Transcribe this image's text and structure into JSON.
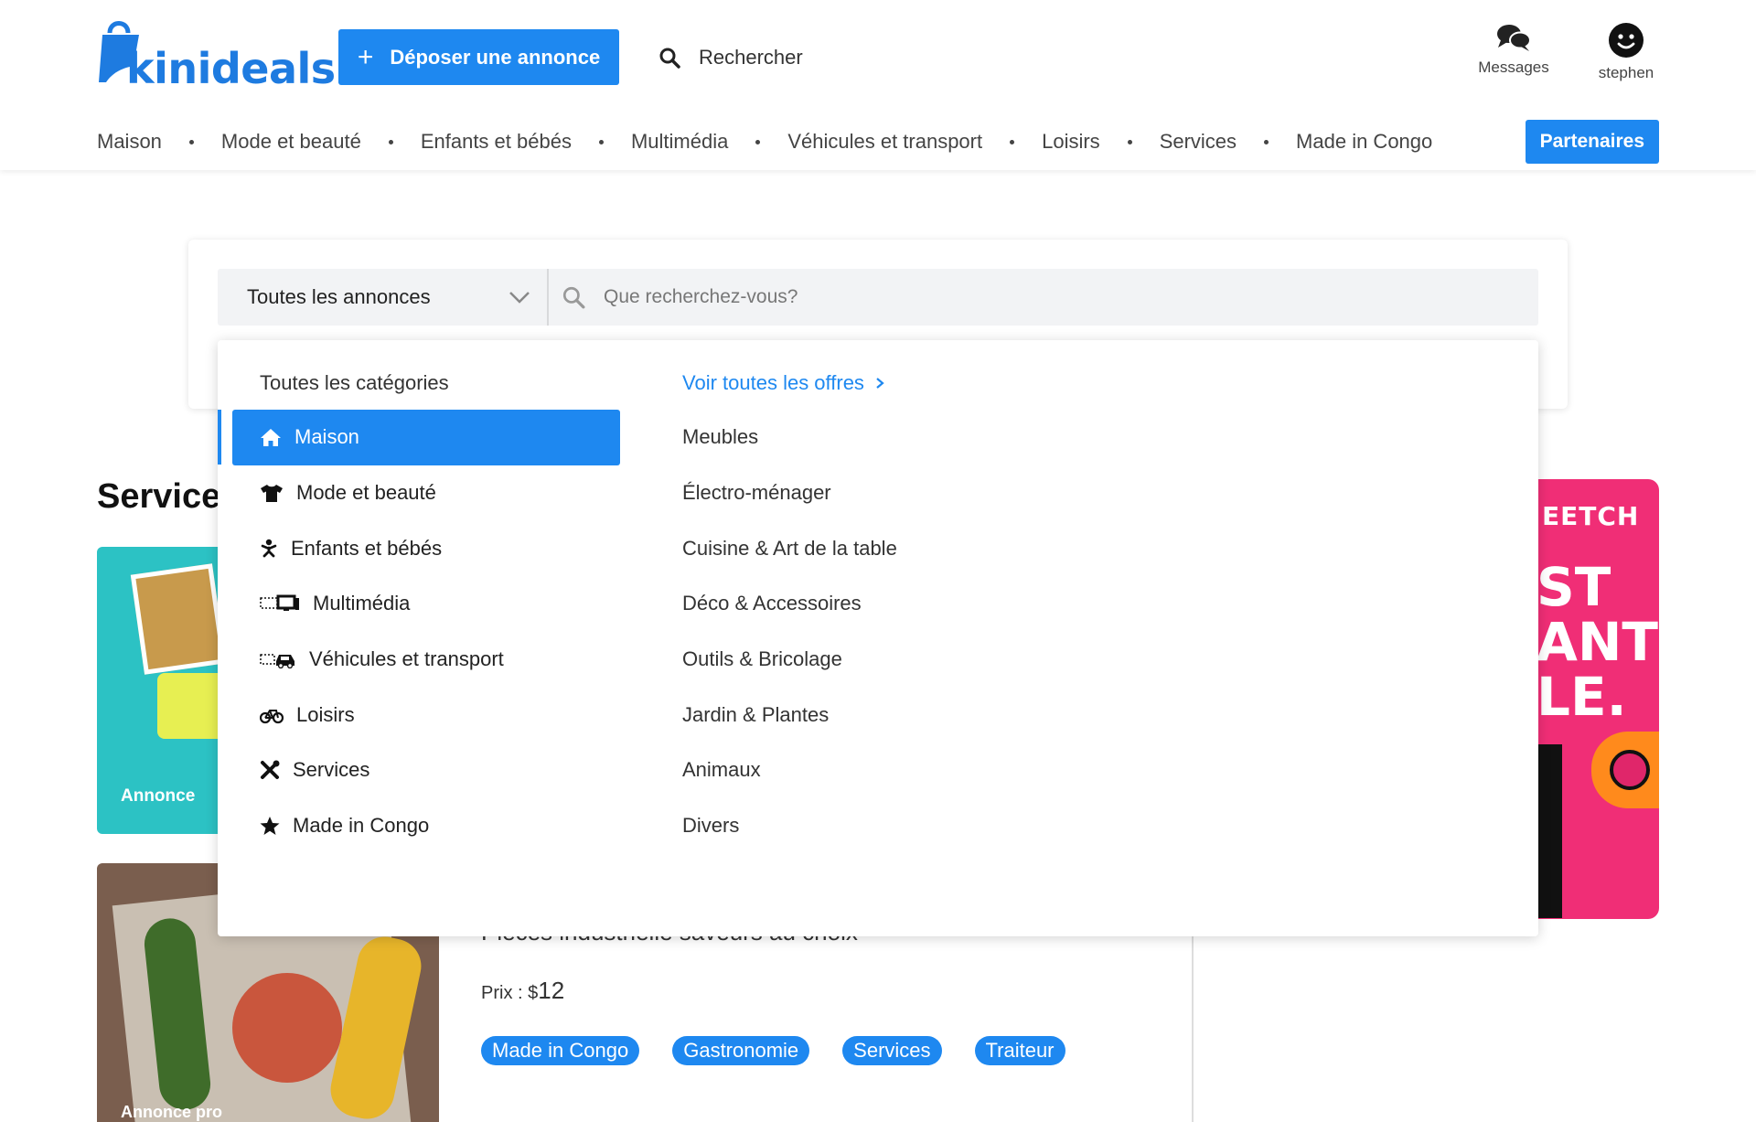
{
  "header": {
    "logo_text": "kinideals",
    "post_button_label": "Déposer une annonce",
    "search_label": "Rechercher",
    "messages_label": "Messages",
    "user_label": "stephen"
  },
  "nav": {
    "items": [
      "Maison",
      "Mode et beauté",
      "Enfants et bébés",
      "Multimédia",
      "Véhicules et transport",
      "Loisirs",
      "Services",
      "Made in Congo"
    ],
    "partners_label": "Partenaires"
  },
  "search": {
    "category_selected": "Toutes les annonces",
    "placeholder": "Que recherchez-vous?"
  },
  "dropdown": {
    "categories_title": "Toutes les catégories",
    "categories": [
      {
        "label": "Maison",
        "icon": "home-icon",
        "active": true
      },
      {
        "label": "Mode et beauté",
        "icon": "tshirt-icon",
        "active": false
      },
      {
        "label": "Enfants et bébés",
        "icon": "baby-icon",
        "active": false
      },
      {
        "label": "Multimédia",
        "icon": "multimedia-icon",
        "active": false
      },
      {
        "label": "Véhicules et transport",
        "icon": "car-icon",
        "active": false
      },
      {
        "label": "Loisirs",
        "icon": "bicycle-icon",
        "active": false
      },
      {
        "label": "Services",
        "icon": "tools-icon",
        "active": false
      },
      {
        "label": "Made in Congo",
        "icon": "star-icon",
        "active": false
      }
    ],
    "see_all_label": "Voir toutes les offres",
    "subcategories": [
      "Meubles",
      "Électro-ménager",
      "Cuisine & Art de la table",
      "Déco & Accessoires",
      "Outils & Bricolage",
      "Jardin & Plantes",
      "Animaux",
      "Divers"
    ]
  },
  "content": {
    "section_title": "Service",
    "card1_label": "Annonce",
    "card2_label": "Annonce pro",
    "card2_title": "Pièces industrielle saveurs au choix",
    "price_label": "Prix :",
    "price_currency": "$",
    "price_value": "12",
    "tags": [
      "Made in Congo",
      "Gastronomie",
      "Services",
      "Traiteur"
    ]
  },
  "ad": {
    "header_text": "EETCH",
    "big_text_lines": [
      "ST",
      "ANT",
      "LE."
    ]
  },
  "colors": {
    "brand_blue": "#1e88f0",
    "ad_pink": "#f02e76"
  }
}
